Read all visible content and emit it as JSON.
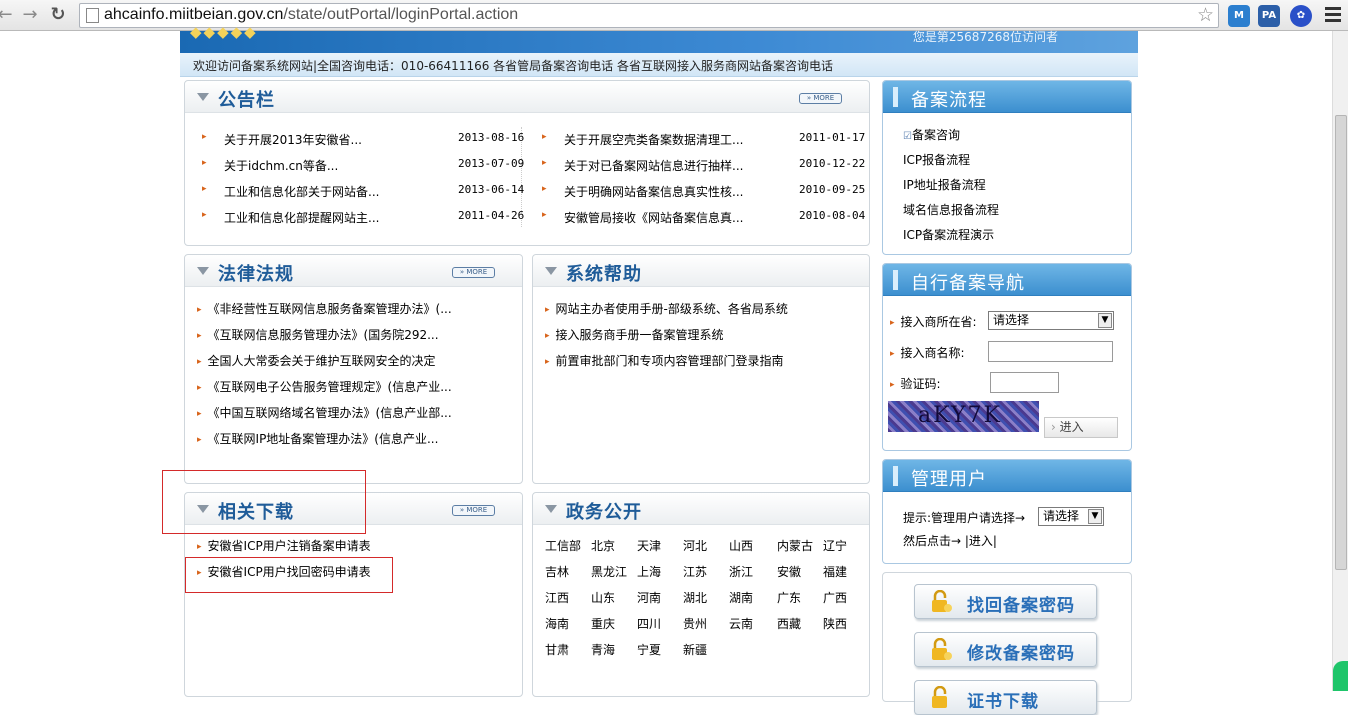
{
  "browser": {
    "url_host": "ahcainfo.miitbeian.gov.cn",
    "url_path": "/state/outPortal/loginPortal.action",
    "ext_labels": [
      "M",
      "PA"
    ]
  },
  "banner": {
    "visitor_text": "您是第25687268位访问者"
  },
  "welcome": "欢迎访问备案系统网站|全国咨询电话：010-66411166 各省管局备案咨询电话 各省互联网接入服务商网站备案咨询电话",
  "notice": {
    "title": "公告栏",
    "more": "MORE",
    "left": [
      {
        "text": "关于开展2013年安徽省...",
        "date": "2013-08-16"
      },
      {
        "text": "关于idchm.cn等备...",
        "date": "2013-07-09"
      },
      {
        "text": "工业和信息化部关于网站备...",
        "date": "2013-06-14"
      },
      {
        "text": "工业和信息化部提醒网站主...",
        "date": "2011-04-26"
      }
    ],
    "right": [
      {
        "text": "关于开展空壳类备案数据清理工...",
        "date": "2011-01-17"
      },
      {
        "text": "关于对已备案网站信息进行抽样...",
        "date": "2010-12-22"
      },
      {
        "text": "关于明确网站备案信息真实性核...",
        "date": "2010-09-25"
      },
      {
        "text": "安徽管局接收《网站备案信息真...",
        "date": "2010-08-04"
      }
    ]
  },
  "law": {
    "title": "法律法规",
    "more": "MORE",
    "items": [
      "《非经营性互联网信息服务备案管理办法》(...",
      "《互联网信息服务管理办法》(国务院292...",
      "全国人大常委会关于维护互联网安全的决定",
      "《互联网电子公告服务管理规定》(信息产业...",
      "《中国互联网络域名管理办法》(信息产业部...",
      "《互联网IP地址备案管理办法》(信息产业..."
    ]
  },
  "help": {
    "title": "系统帮助",
    "items": [
      "网站主办者使用手册-部级系统、各省局系统",
      "接入服务商手册一备案管理系统",
      "前置审批部门和专项内容管理部门登录指南"
    ]
  },
  "download": {
    "title": "相关下载",
    "more": "MORE",
    "items": [
      "安徽省ICP用户注销备案申请表",
      "安徽省ICP用户找回密码申请表"
    ]
  },
  "gov": {
    "title": "政务公开",
    "rows": [
      [
        "工信部",
        "北京",
        "天津",
        "河北",
        "山西",
        "内蒙古",
        "辽宁"
      ],
      [
        "吉林",
        "黑龙江",
        "上海",
        "江苏",
        "浙江",
        "安徽",
        "福建"
      ],
      [
        "江西",
        "山东",
        "河南",
        "湖北",
        "湖南",
        "广东",
        "广西"
      ],
      [
        "海南",
        "重庆",
        "四川",
        "贵州",
        "云南",
        "西藏",
        "陕西"
      ],
      [
        "甘肃",
        "青海",
        "宁夏",
        "新疆"
      ]
    ]
  },
  "process": {
    "title": "备案流程",
    "items": [
      "备案咨询",
      "ICP报备流程",
      "IP地址报备流程",
      "域名信息报备流程",
      "ICP备案流程演示"
    ]
  },
  "nav": {
    "title": "自行备案导航",
    "province_label": "接入商所在省:",
    "province_value": "请选择",
    "name_label": "接入商名称:",
    "captcha_label": "验证码:",
    "captcha_text": "aKY7K",
    "enter": "进入"
  },
  "manage": {
    "title": "管理用户",
    "hint_label": "提示:管理用户请选择→",
    "select_value": "请选择",
    "then_label": "然后点击→",
    "enter_link": "|进入|"
  },
  "buttons": [
    {
      "label": "找回备案密码"
    },
    {
      "label": "修改备案密码"
    },
    {
      "label": "证书下载"
    }
  ]
}
